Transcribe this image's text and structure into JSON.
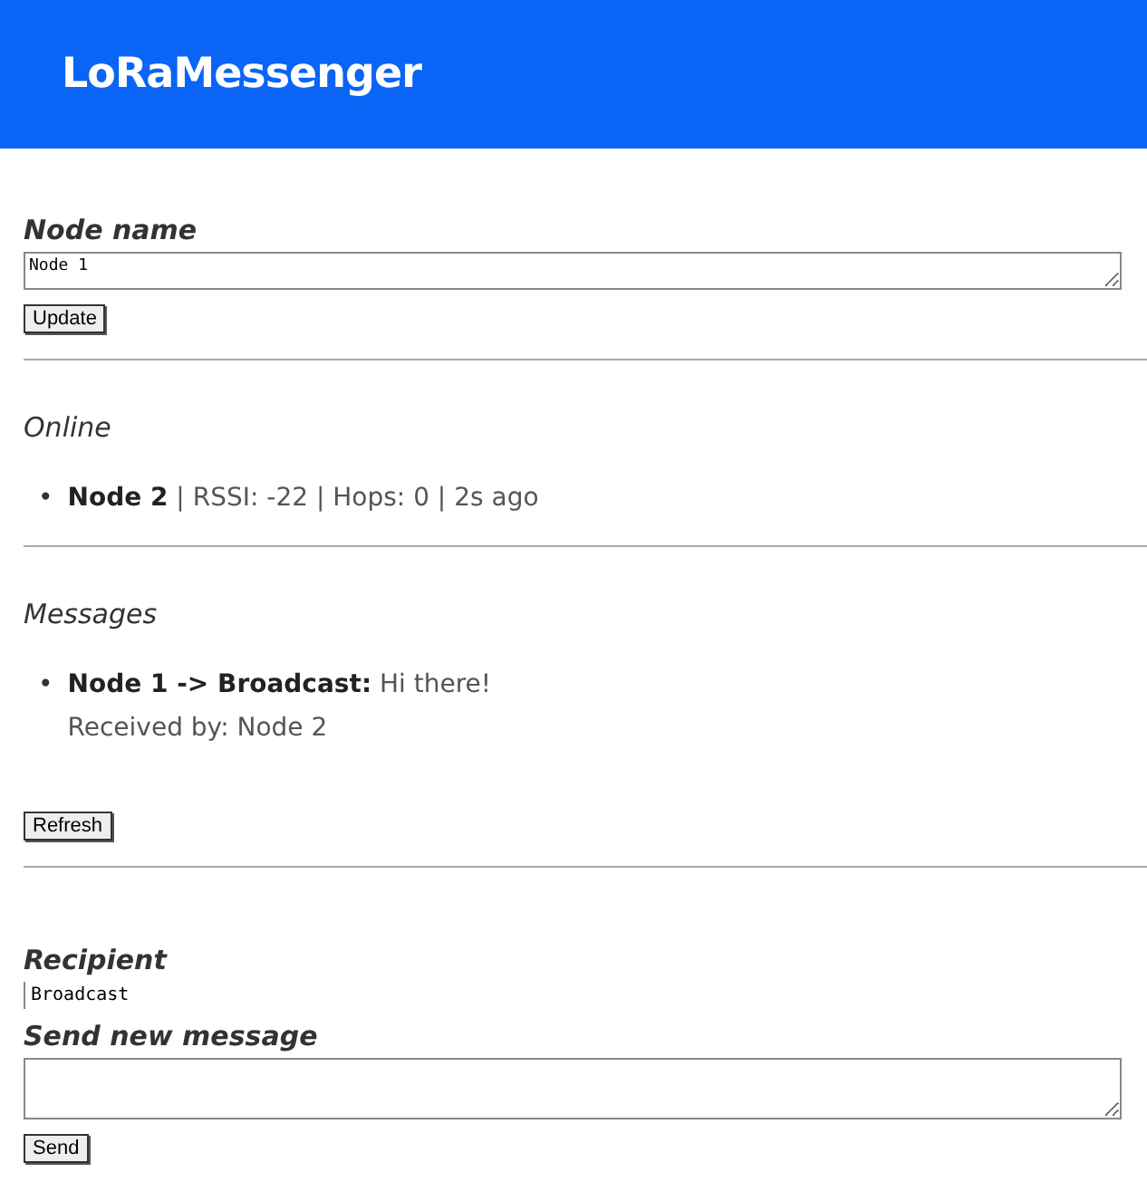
{
  "header": {
    "title": "LoRaMessenger"
  },
  "node_name": {
    "label": "Node name",
    "value": "Node 1",
    "button": "Update"
  },
  "bullet": "•",
  "online": {
    "heading": "Online",
    "items": [
      "**Node 2** | RSSI: -22 | Hops: 0 | 2s ago"
    ]
  },
  "messages": {
    "heading": "Messages",
    "items": [
      {
        "text": "**Node 1 -> Broadcast:** Hi there!",
        "received": "Received by: Node 2"
      }
    ],
    "button": "Refresh"
  },
  "compose": {
    "recipient_label": "Recipient",
    "recipient_value": "Broadcast",
    "message_label": "Send new message",
    "button": "Send"
  }
}
